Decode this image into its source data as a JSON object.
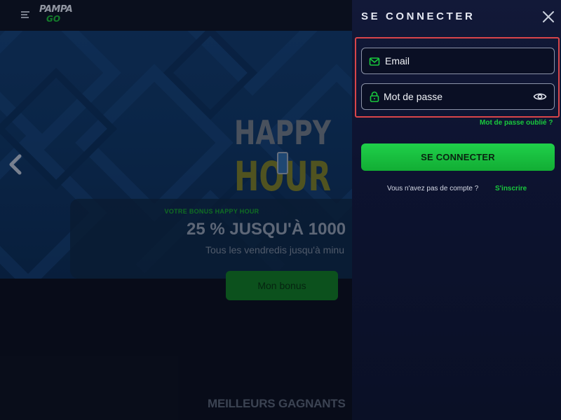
{
  "background": {
    "logo": {
      "line1": "PAMPA",
      "line2": "GO"
    },
    "happy_hour": {
      "line1": "HAPPY",
      "line2": "HOUR"
    },
    "bonus": {
      "label": "VOTRE BONUS HAPPY HOUR",
      "title": "25 % JUSQU'À 1000",
      "subtitle": "Tous les vendredis jusqu'à minu",
      "button": "Mon bonus"
    },
    "section_title": "MEILLEURS GAGNANTS"
  },
  "panel": {
    "title": "SE CONNECTER",
    "email_placeholder": "Email",
    "password_placeholder": "Mot de passe",
    "forgot_link": "Mot de passe oublié ?",
    "login_button": "SE CONNECTER",
    "no_account_text": "Vous n'avez pas de compte ?",
    "signup_link": "S'inscrire"
  },
  "colors": {
    "accent_green": "#19c93d",
    "highlight_red": "#d9454a",
    "panel_bg": "#0d1330"
  }
}
